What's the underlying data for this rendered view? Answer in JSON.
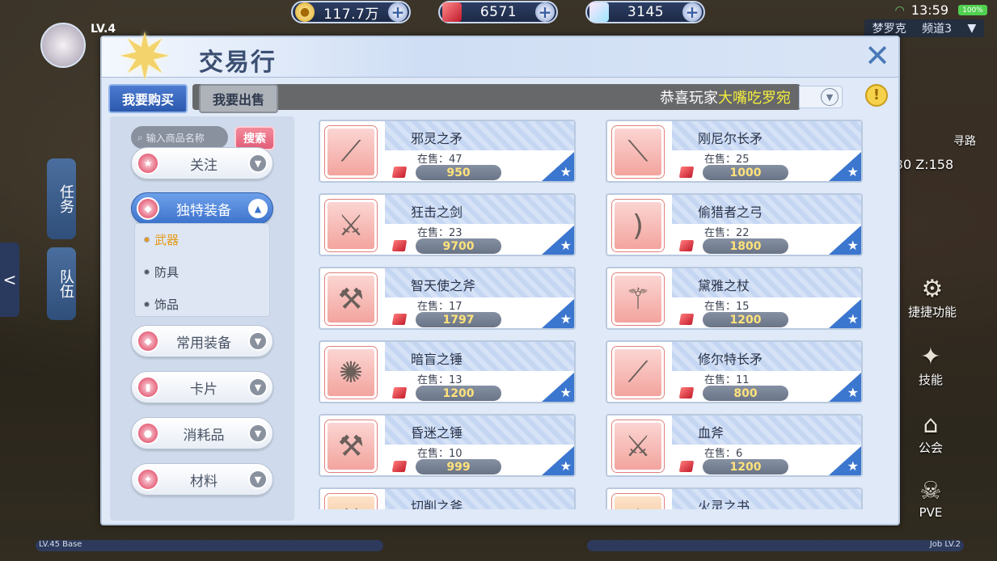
{
  "currency": {
    "gold": "117.7万",
    "red_gem": "6571",
    "diamond": "3145"
  },
  "status": {
    "time": "13:59",
    "battery": "100%"
  },
  "server": {
    "name": "梦罗克",
    "channel": "频道3"
  },
  "player": {
    "level": "LV.4"
  },
  "side_tabs": {
    "task": "任务",
    "team": "队伍"
  },
  "right_icons": {
    "shortcut": "捷捷功能",
    "skill": "技能",
    "guild": "公会",
    "pve": "PVE",
    "pathfind": "寻路",
    "coord": "30 Z:158"
  },
  "xp_bars": {
    "base": "LV.45 Base",
    "job": "Job LV.2"
  },
  "panel": {
    "title": "交易行",
    "tab_buy": "我要购买",
    "tab_sell": "我要出售",
    "marquee_prefix": "恭喜玩家",
    "marquee_highlight": "大嘴吃罗宛"
  },
  "filter": {
    "search_placeholder": "输入商品名称",
    "search_button": "搜索",
    "categories": [
      {
        "label": "关注"
      },
      {
        "label": "独特装备"
      },
      {
        "label": "常用装备"
      },
      {
        "label": "卡片"
      },
      {
        "label": "消耗品"
      },
      {
        "label": "材料"
      }
    ],
    "subitems": [
      {
        "label": "武器"
      },
      {
        "label": "防具"
      },
      {
        "label": "饰品"
      }
    ]
  },
  "items": [
    {
      "name": "邪灵之矛",
      "stock_label": "在售：47",
      "price": "950",
      "icon": "spear-icon"
    },
    {
      "name": "刚尼尔长矛",
      "stock_label": "在售：25",
      "price": "1000",
      "icon": "lance-icon"
    },
    {
      "name": "狂击之剑",
      "stock_label": "在售：23",
      "price": "9700",
      "icon": "sword-icon"
    },
    {
      "name": "偷猎者之弓",
      "stock_label": "在售：22",
      "price": "1800",
      "icon": "bow-icon"
    },
    {
      "name": "智天使之斧",
      "stock_label": "在售：17",
      "price": "1797",
      "icon": "axe-icon"
    },
    {
      "name": "黛雅之杖",
      "stock_label": "在售：15",
      "price": "1200",
      "icon": "staff-icon"
    },
    {
      "name": "暗盲之锤",
      "stock_label": "在售：13",
      "price": "1200",
      "icon": "mace-icon"
    },
    {
      "name": "修尔特长矛",
      "stock_label": "在售：11",
      "price": "800",
      "icon": "pike-icon"
    },
    {
      "name": "昏迷之锤",
      "stock_label": "在售：10",
      "price": "999",
      "icon": "hammer-icon"
    },
    {
      "name": "血斧",
      "stock_label": "在售：6",
      "price": "1200",
      "icon": "blood-axe-icon"
    },
    {
      "name": "切削之斧",
      "icon": "cutting-axe-icon"
    },
    {
      "name": "火灵之书",
      "icon": "fire-book-icon"
    }
  ]
}
